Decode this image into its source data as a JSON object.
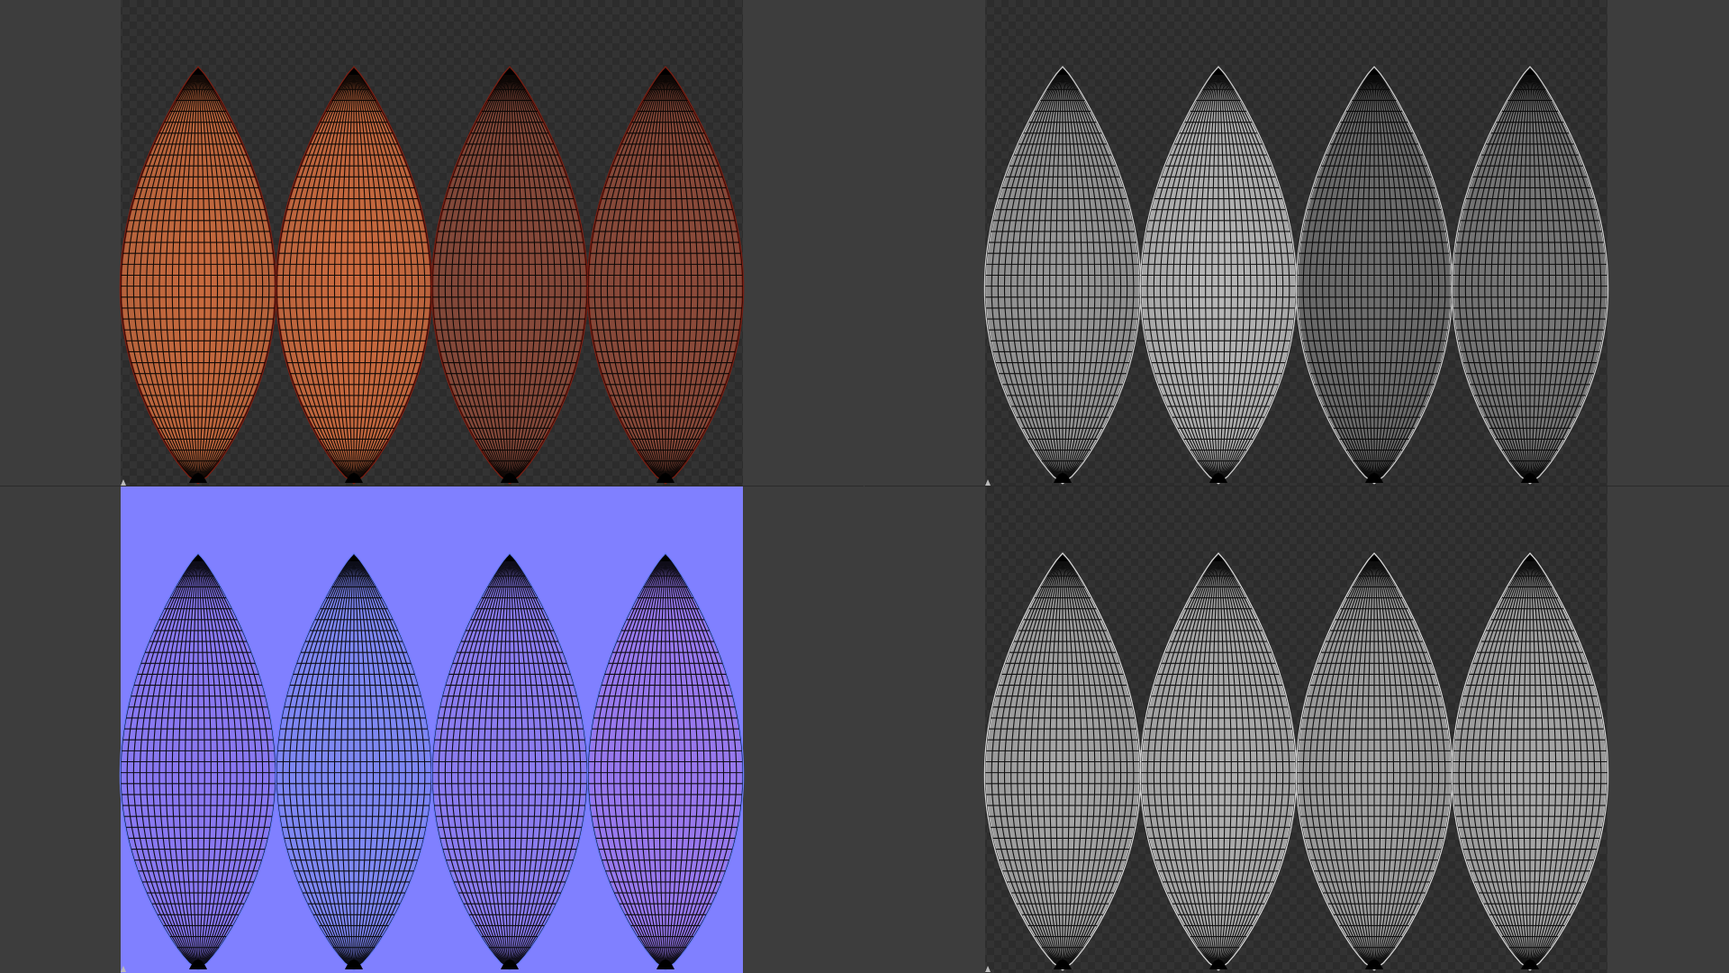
{
  "viewports": [
    {
      "id": "base-color",
      "map_type": "base-color",
      "background": "checker",
      "gore_colors": [
        "#c86a3e",
        "#cd6b3f",
        "#8a4a3a",
        "#8f4b3a"
      ],
      "edge_color": "#7a1e12",
      "wire_color": "#000000",
      "uv_mark_icon": "uv-origin-icon"
    },
    {
      "id": "roughness",
      "map_type": "roughness",
      "background": "checker",
      "gore_colors": [
        "#9a9a9a",
        "#b8b8b8",
        "#6f6f6f",
        "#7a7a7a"
      ],
      "edge_color": "#cfcfcf",
      "wire_color": "#000000",
      "uv_mark_icon": "uv-origin-icon"
    },
    {
      "id": "normal",
      "map_type": "normal",
      "background": "#8080ff",
      "gore_colors": [
        "#8a78f0",
        "#7e88f2",
        "#8c7cee",
        "#9a78ec"
      ],
      "edge_color": "#6a7cff",
      "wire_color": "#000000",
      "uv_mark_icon": "uv-origin-icon"
    },
    {
      "id": "height",
      "map_type": "height",
      "background": "checker",
      "gore_colors": [
        "#a8a8a8",
        "#b0b0b0",
        "#a4a4a4",
        "#a9a9a9"
      ],
      "edge_color": "#d9d9d9",
      "wire_color": "#000000",
      "uv_mark_icon": "uv-origin-icon"
    }
  ]
}
